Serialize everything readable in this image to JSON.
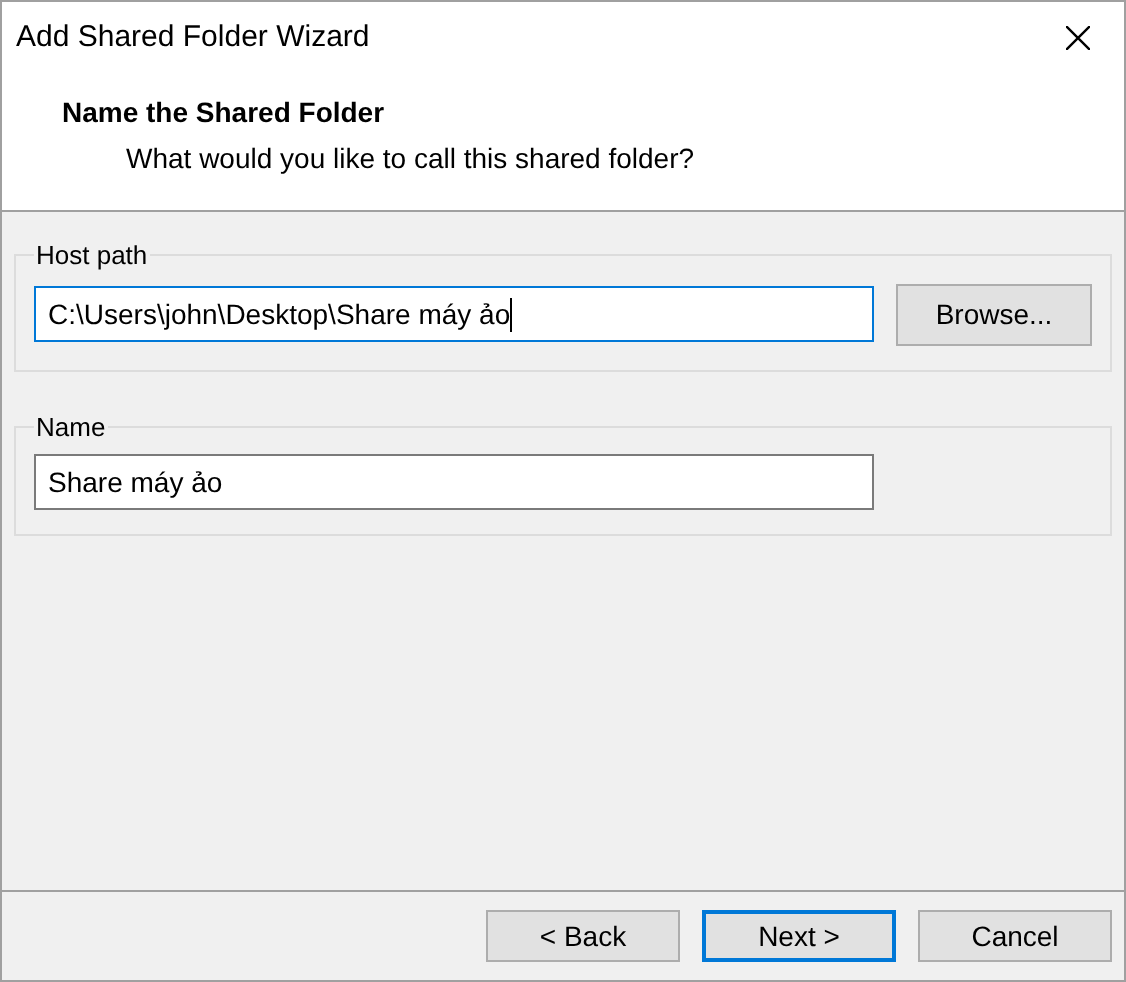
{
  "window": {
    "title": "Add Shared Folder Wizard"
  },
  "header": {
    "title": "Name the Shared Folder",
    "subtitle": "What would you like to call this shared folder?"
  },
  "groups": [
    {
      "label": "Host path",
      "field": {
        "value": "C:\\Users\\john\\Desktop\\Share máy ảo",
        "focused": true
      },
      "button": "Browse..."
    },
    {
      "label": "Name",
      "field": {
        "value": "Share máy ảo",
        "focused": false
      }
    }
  ],
  "buttons": [
    {
      "label": "< Back",
      "default": false
    },
    {
      "label": "Next >",
      "default": true
    },
    {
      "label": "Cancel",
      "default": false
    }
  ]
}
